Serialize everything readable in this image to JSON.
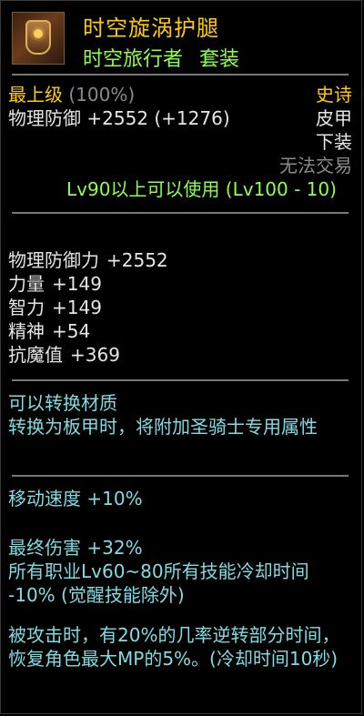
{
  "item": {
    "name": "时空旋涡护腿",
    "set_name": "时空旅行者",
    "set_suffix": "套装",
    "icon": "leg-armor-icon",
    "grade": "最上级",
    "grade_pct": "(100%)",
    "rarity": "史诗",
    "defense_label": "物理防御",
    "defense_value": "+2552",
    "defense_bonus": "(+1276)",
    "armor_type": "皮甲",
    "slot": "下装",
    "tradeable": "无法交易",
    "level_req": "Lv90以上可以使用 (Lv100 - 10)"
  },
  "stats": [
    {
      "label": "物理防御力",
      "value": "+2552"
    },
    {
      "label": "力量",
      "value": "+149"
    },
    {
      "label": "智力",
      "value": "+149"
    },
    {
      "label": "精神",
      "value": "+54"
    },
    {
      "label": "抗魔值",
      "value": "+369"
    }
  ],
  "convert": {
    "line1": "可以转换材质",
    "line2": "转换为板甲时，将附加圣骑士专用属性"
  },
  "effects": {
    "move_speed_label": "移动速度",
    "move_speed_value": "+10%",
    "final_damage_label": "最终伤害",
    "final_damage_value": "+32%",
    "cooldown_text": "所有职业Lv60~80所有技能冷却时间 -10% (觉醒技能除外)",
    "counter_text": "被攻击时，有20%的几率逆转部分时间，恢复角色最大MP的5%。(冷却时间10秒)"
  },
  "colors": {
    "gold": "#ffcc00",
    "green": "#8cff4f",
    "teal": "#80dce2",
    "gray": "#8a8a8a",
    "background": "#000000"
  }
}
